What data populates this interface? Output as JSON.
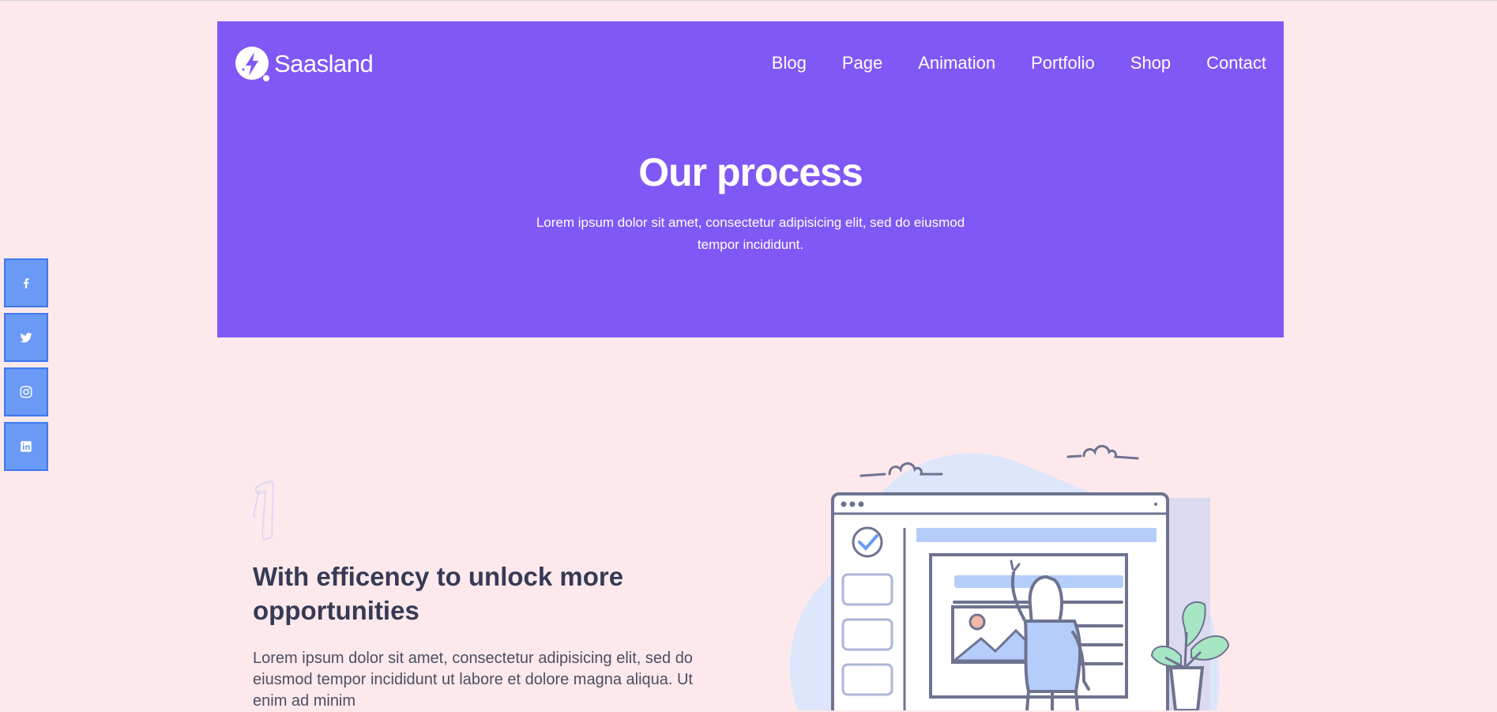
{
  "brand": {
    "name": "Saasland"
  },
  "nav": {
    "items": [
      "Blog",
      "Page",
      "Animation",
      "Portfolio",
      "Shop",
      "Contact"
    ]
  },
  "hero": {
    "title": "Our process",
    "subtitle": "Lorem ipsum dolor sit amet, consectetur adipisicing elit, sed do eiusmod tempor incididunt."
  },
  "social": [
    "facebook",
    "twitter",
    "instagram",
    "linkedin"
  ],
  "step": {
    "number": "1",
    "title": "With efficency to unlock more opportunities",
    "text": "Lorem ipsum dolor sit amet, consectetur adipisicing elit, sed do eiusmod tempor incididunt ut labore et dolore magna aliqua. Ut enim ad minim"
  },
  "colors": {
    "hero_bg": "#8058f5",
    "page_bg": "#fde9ec",
    "social_bg": "#6a9af6",
    "heading": "#363a55"
  }
}
